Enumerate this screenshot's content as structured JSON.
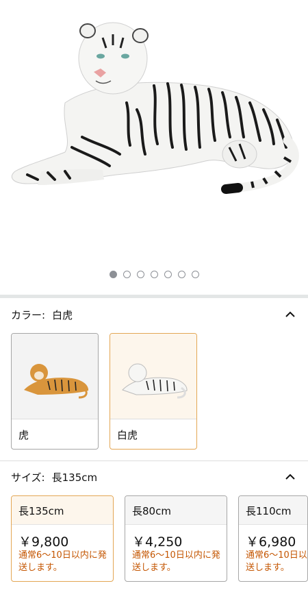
{
  "carousel": {
    "image_label": "white-tiger-plush",
    "dot_count": 7,
    "active_index": 0
  },
  "color": {
    "label": "カラー:",
    "selected": "白虎",
    "options": [
      {
        "name": "虎",
        "image": "orange-tiger-plush"
      },
      {
        "name": "白虎",
        "image": "white-tiger-plush"
      }
    ]
  },
  "size": {
    "label": "サイズ:",
    "selected": "長135cm",
    "options": [
      {
        "name": "長135cm",
        "price": "￥9,800",
        "shipping": "通常6～10日以内に発送します。"
      },
      {
        "name": "長80cm",
        "price": "￥4,250",
        "shipping": "通常6～10日以内に発送します。"
      },
      {
        "name": "長110cm",
        "price": "￥6,980",
        "shipping": "通常6～10日以内に発送します。"
      }
    ]
  },
  "colors": {
    "accent_border": "#e3a653",
    "shipping_text": "#c45500",
    "divider": "#e3e6e6"
  }
}
